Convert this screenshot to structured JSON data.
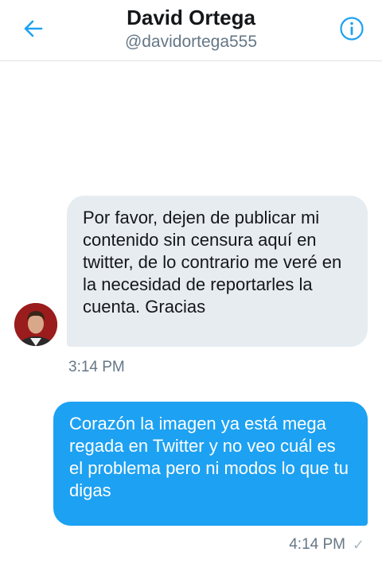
{
  "header": {
    "title": "David Ortega",
    "handle": "@davidortega555",
    "back_icon": "arrow-left-icon",
    "info_icon": "info-circle-icon"
  },
  "colors": {
    "accent": "#1da1f2",
    "incoming_bubble": "#e6ecf0",
    "text": "#14171a",
    "muted": "#657786"
  },
  "messages": [
    {
      "direction": "incoming",
      "text": "Por favor, dejen de publicar mi contenido sin censura aquí en twitter, de lo contrario me veré en la necesidad de reportarles la cuenta. Gracias",
      "time": "3:14 PM"
    },
    {
      "direction": "outgoing",
      "text": "Corazón la imagen ya está mega regada en Twitter y no veo cuál es el problema pero ni modos lo que tu digas",
      "time": "4:14 PM",
      "status_icon": "checkmark-icon"
    }
  ]
}
